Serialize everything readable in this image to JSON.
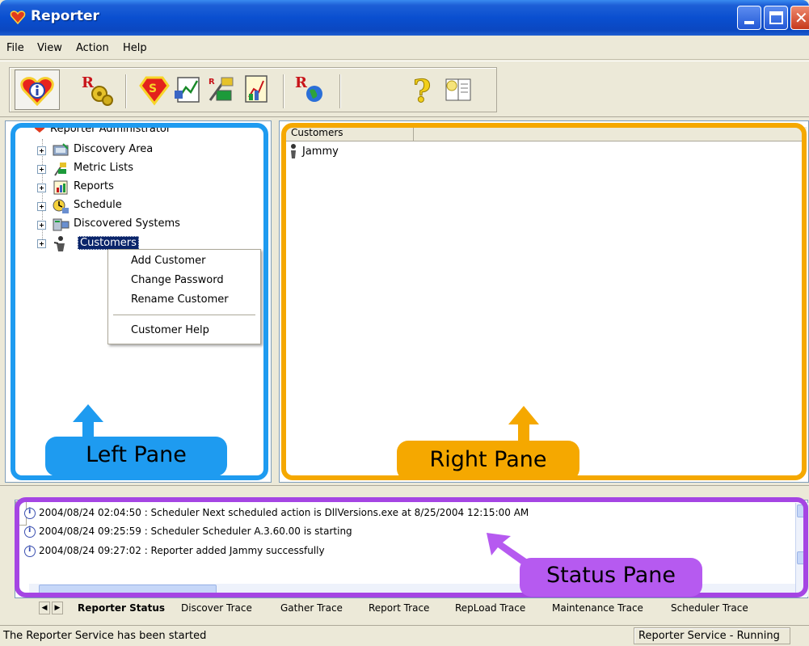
{
  "window": {
    "title": "Reporter",
    "icon": "reporter-app-icon",
    "controls": [
      "minimize",
      "maximize",
      "close"
    ]
  },
  "menu": {
    "items": [
      "File",
      "View",
      "Action",
      "Help"
    ]
  },
  "toolbar": {
    "buttons": [
      {
        "icon": "info-heart-icon"
      },
      {
        "icon": "reporter-gears-icon"
      },
      {
        "icon": "superman-shield-icon"
      },
      {
        "icon": "discovery-chart-icon"
      },
      {
        "icon": "metric-list-icon"
      },
      {
        "icon": "report-chart-icon"
      },
      {
        "icon": "reporter-globe-icon"
      },
      {
        "icon": "help-question-icon"
      },
      {
        "icon": "help-book-icon"
      }
    ]
  },
  "tree": {
    "root": "Reporter Administrator",
    "items": [
      {
        "label": "Discovery Area",
        "icon": "discovery-area-icon"
      },
      {
        "label": "Metric Lists",
        "icon": "metric-lists-icon"
      },
      {
        "label": "Reports",
        "icon": "reports-icon"
      },
      {
        "label": "Schedule",
        "icon": "schedule-icon"
      },
      {
        "label": "Discovered Systems",
        "icon": "discovered-systems-icon"
      },
      {
        "label": "Customers",
        "icon": "customers-icon",
        "selected": true
      }
    ]
  },
  "context_menu": {
    "items": [
      "Add Customer",
      "Change Password",
      "Rename Customer",
      "Customer Help"
    ]
  },
  "list": {
    "column": "Customers",
    "rows": [
      "Jammy"
    ]
  },
  "callouts": {
    "left": "Left Pane",
    "right": "Right Pane",
    "status": "Status Pane"
  },
  "status_log": [
    "2004/08/24 02:04:50 : Scheduler Next scheduled action is DllVersions.exe at 8/25/2004 12:15:00 AM",
    "2004/08/24 09:25:59 : Scheduler Scheduler A.3.60.00 is starting",
    "2004/08/24 09:27:02 : Reporter added Jammy successfully"
  ],
  "tabs": [
    {
      "label": "Reporter Status",
      "active": true
    },
    {
      "label": "Discover Trace"
    },
    {
      "label": "Gather Trace"
    },
    {
      "label": "Report Trace"
    },
    {
      "label": "RepLoad Trace"
    },
    {
      "label": "Maintenance Trace"
    },
    {
      "label": "Scheduler Trace"
    }
  ],
  "statusbar": {
    "message": "The Reporter Service has been started",
    "service_state": "Reporter Service - Running"
  },
  "colors": {
    "left_pane_highlight": "#1e9bf0",
    "right_pane_highlight": "#f5a800",
    "status_pane_highlight": "#a545e3",
    "selection": "#0a246a"
  }
}
